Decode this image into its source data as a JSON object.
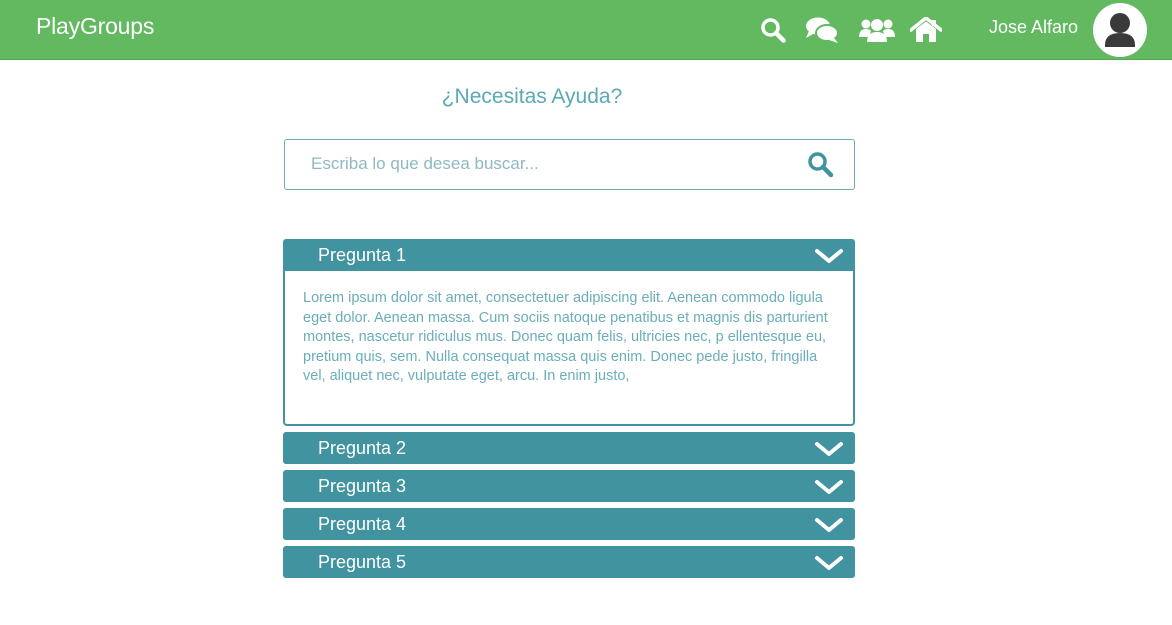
{
  "header": {
    "brand": "PlayGroups",
    "user_name": "Jose Alfaro",
    "icons": [
      "search-icon",
      "chat-icon",
      "users-icon",
      "home-icon",
      "user-avatar-icon"
    ],
    "background_color": "#62b960"
  },
  "help": {
    "title": "¿Necesitas Ayuda?"
  },
  "search": {
    "placeholder": "Escriba lo que desea buscar...",
    "value": ""
  },
  "faq": {
    "accent_color": "#40939f",
    "items": [
      {
        "label": "Pregunta 1",
        "expanded": true,
        "answer": "Lorem ipsum dolor sit amet, consectetuer adipiscing elit. Aenean commodo ligula eget dolor. Aenean massa. Cum sociis natoque penatibus et magnis dis parturient montes, nascetur ridiculus mus. Donec quam felis, ultricies nec, p ellentesque eu, pretium quis, sem. Nulla consequat massa quis enim. Donec pede justo, fringilla vel, aliquet nec, vulputate eget, arcu. In enim justo,"
      },
      {
        "label": "Pregunta 2",
        "expanded": false
      },
      {
        "label": "Pregunta 3",
        "expanded": false
      },
      {
        "label": "Pregunta 4",
        "expanded": false
      },
      {
        "label": "Pregunta 5",
        "expanded": false
      }
    ]
  }
}
